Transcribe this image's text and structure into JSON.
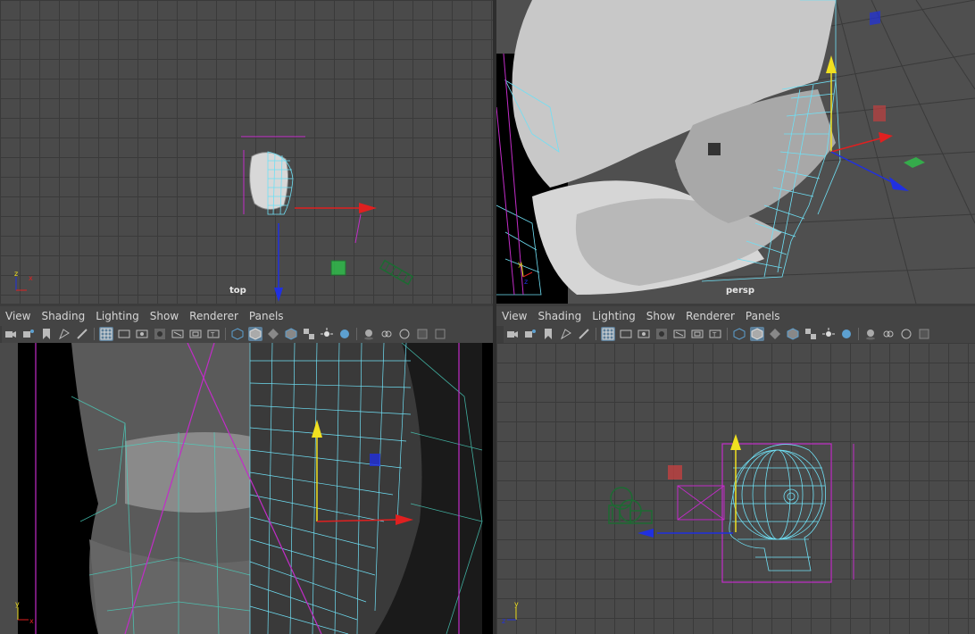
{
  "viewports": {
    "top_left": {
      "label": "top"
    },
    "top_right": {
      "label": "persp"
    }
  },
  "panel_menu_left": [
    "View",
    "Shading",
    "Lighting",
    "Show",
    "Renderer",
    "Panels"
  ],
  "panel_menu_right": [
    "View",
    "Shading",
    "Lighting",
    "Show",
    "Renderer",
    "Panels"
  ],
  "toolbar_icons": [
    "camera-icon",
    "camera-attr-icon",
    "bookmark-icon",
    "image-plane-icon",
    "grease-pencil-icon",
    "grid-icon",
    "film-gate-icon",
    "resolution-gate-icon",
    "gate-mask-icon",
    "field-chart-icon",
    "safe-action-icon",
    "safe-title-icon",
    "wireframe-icon",
    "smooth-shade-icon",
    "flat-shade-icon",
    "wireframe-on-shaded-icon",
    "textured-icon",
    "lights-icon",
    "shadows-icon",
    "screen-ao-icon",
    "motion-blur-icon",
    "antialias-icon",
    "depth-of-field-icon",
    "isolate-icon",
    "xray-icon"
  ],
  "axis": {
    "x": "x",
    "y": "y",
    "z": "z"
  },
  "colors": {
    "wire": "#6fe0f5",
    "select": "#c22cc8",
    "grid": "#4a4a4a",
    "xaxis": "#e02020",
    "yaxis": "#f0e020",
    "zaxis": "#2030e0",
    "accent": "#5d7f99"
  }
}
